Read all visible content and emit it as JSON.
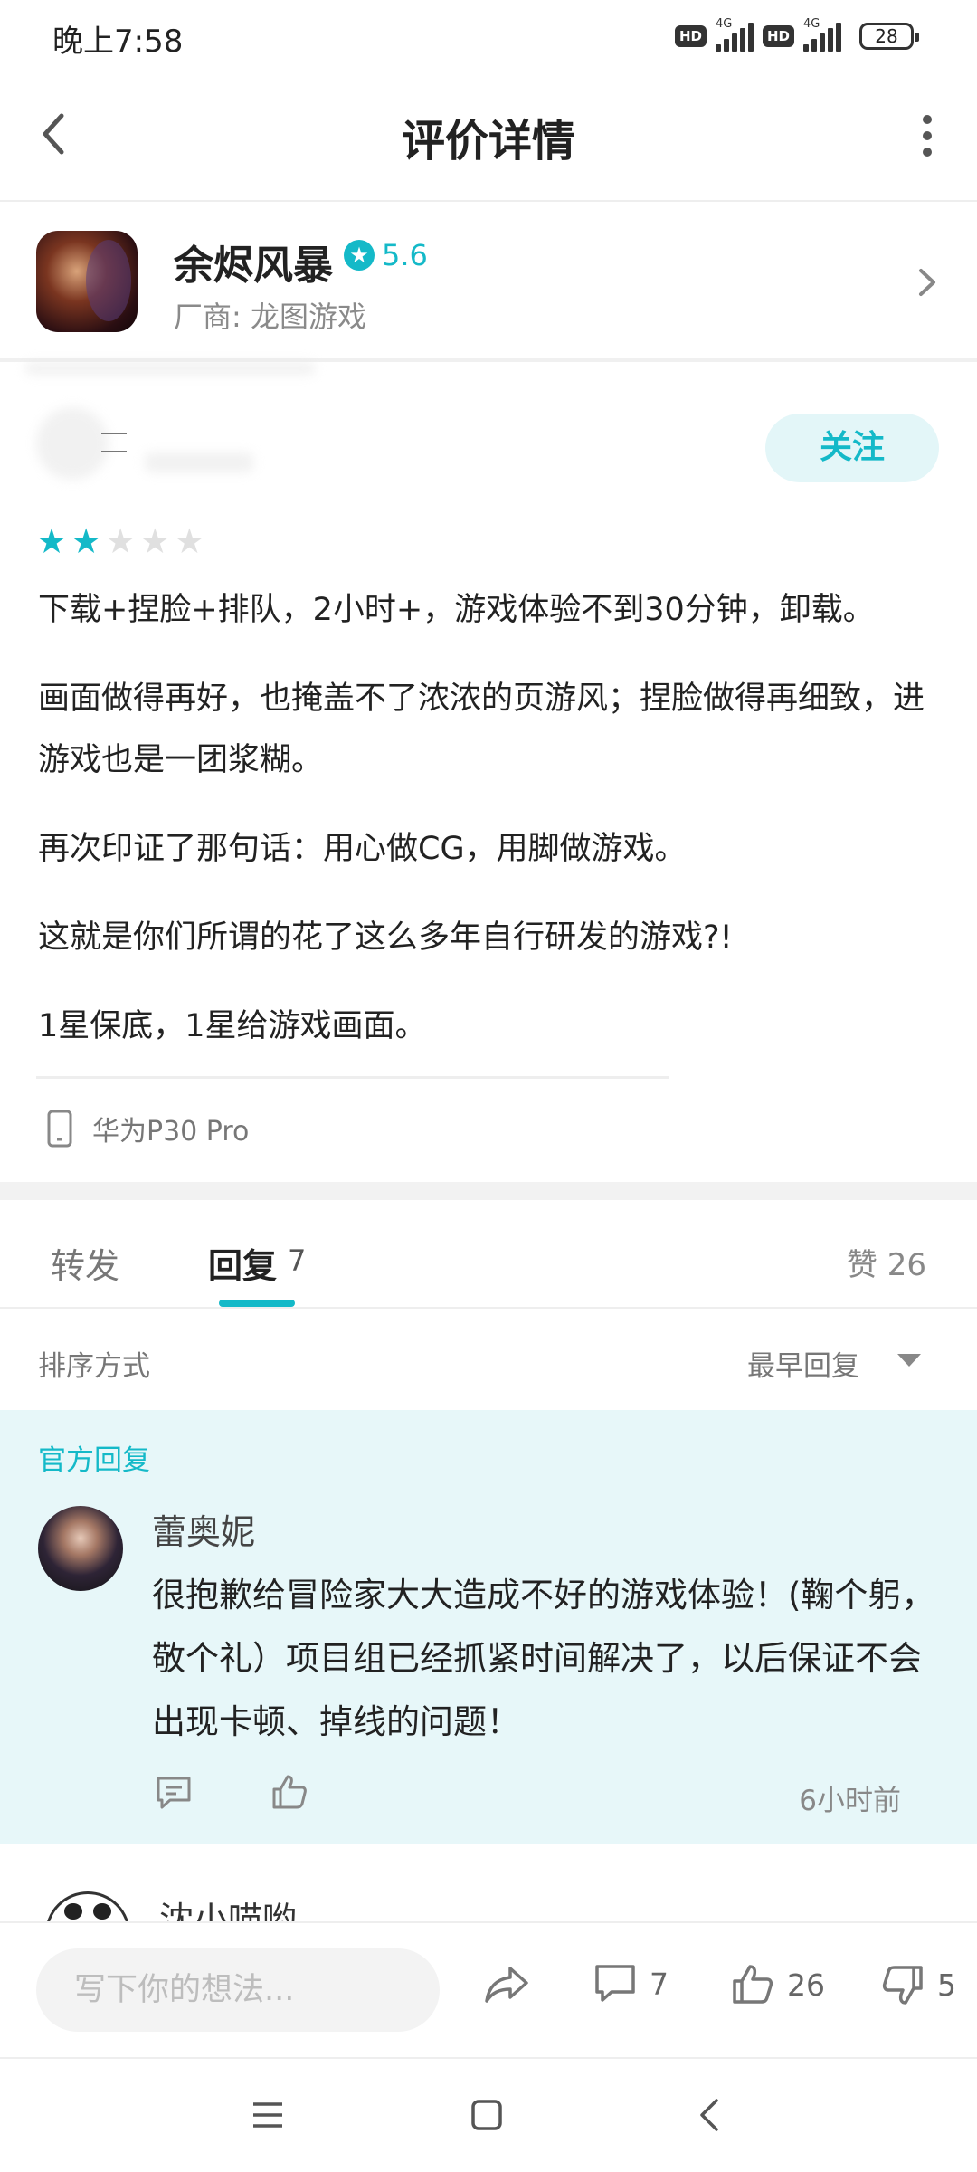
{
  "status_bar": {
    "time": "晚上7:58",
    "hd1": "HD",
    "hd2": "HD",
    "net1": "4G",
    "net2": "4G",
    "battery": "28"
  },
  "header": {
    "title": "评价详情"
  },
  "game": {
    "name": "余烬风暴",
    "rating": "5.6",
    "vendor": "厂商: 龙图游戏"
  },
  "author": {
    "follow_label": "关注"
  },
  "review": {
    "stars_filled": 2,
    "stars_total": 5,
    "paragraphs": [
      "下载+捏脸+排队，2小时+，游戏体验不到30分钟，卸载。",
      "画面做得再好，也掩盖不了浓浓的页游风；捏脸做得再细致，进游戏也是一团浆糊。",
      "再次印证了那句话：用心做CG，用脚做游戏。",
      "这就是你们所谓的花了这么多年自行研发的游戏?!",
      "1星保底，1星给游戏画面。"
    ],
    "device": "华为P30 Pro"
  },
  "tabs": {
    "forward": "转发",
    "reply": "回复",
    "reply_count": "7",
    "likes": "赞 26"
  },
  "sort": {
    "label": "排序方式",
    "value": "最早回复"
  },
  "official_reply": {
    "tag": "官方回复",
    "name": "蕾奥妮",
    "text": "很抱歉给冒险家大大造成不好的游戏体验！(鞠个躬，敬个礼）项目组已经抓紧时间解决了，以后保证不会出现卡顿、掉线的问题！",
    "time": "6小时前"
  },
  "next_comment": {
    "name": "沈小喵哟"
  },
  "bottom_bar": {
    "placeholder": "写下你的想法...",
    "comments": "7",
    "likes": "26",
    "dislikes": "5"
  },
  "colors": {
    "accent": "#14b9c8",
    "official_bg": "#e7f7f9",
    "follow_bg": "#e3f6f8"
  },
  "icons": {
    "share": "share-icon",
    "comment": "comment-icon",
    "like": "thumbs-up-icon",
    "dislike": "thumbs-down-icon",
    "phone": "phone-icon"
  }
}
